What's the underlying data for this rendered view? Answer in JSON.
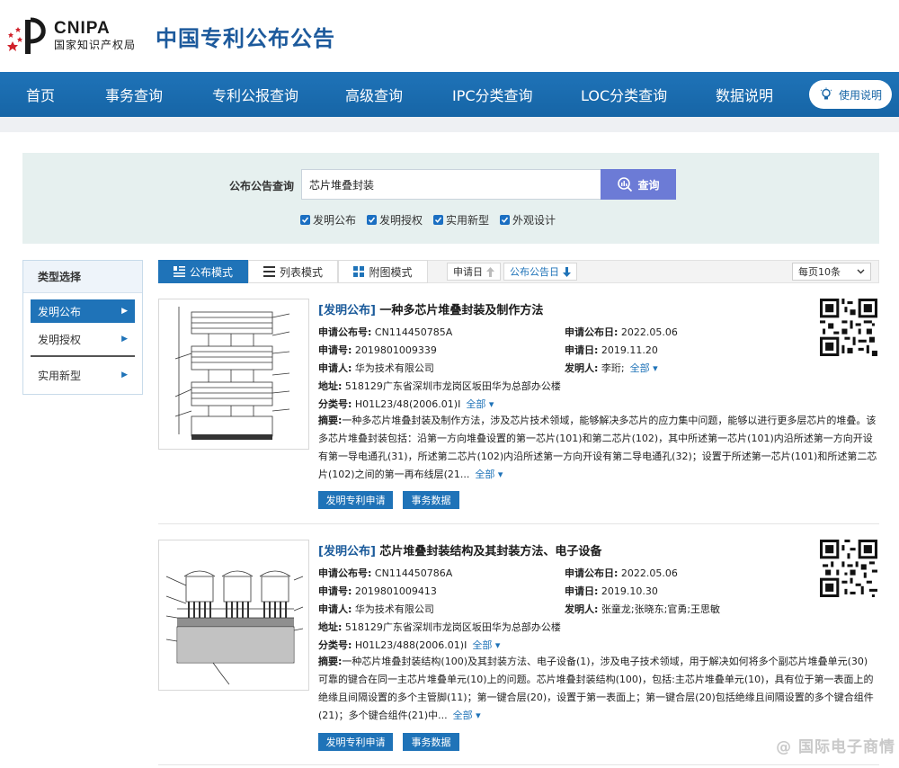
{
  "header": {
    "logo_en": "CNIPA",
    "logo_cn": "国家知识产权局",
    "site_title": "中国专利公布公告"
  },
  "nav": {
    "items": [
      "首页",
      "事务查询",
      "专利公报查询",
      "高级查询",
      "IPC分类查询",
      "LOC分类查询",
      "数据说明"
    ],
    "help_label": "使用说明"
  },
  "search": {
    "label": "公布公告查询",
    "query": "芯片堆叠封装",
    "button": "查询",
    "checks": [
      "发明公布",
      "发明授权",
      "实用新型",
      "外观设计"
    ]
  },
  "sidebar": {
    "title": "类型选择",
    "items": [
      "发明公布",
      "发明授权",
      "实用新型"
    ],
    "active": "发明公布"
  },
  "toolbar": {
    "modes": [
      "公布模式",
      "列表模式",
      "附图模式"
    ],
    "sort": [
      "申请日",
      "公布公告日"
    ],
    "per_page": "每页10条"
  },
  "results": [
    {
      "tag": "[发明公布]",
      "title": "一种多芯片堆叠封装及制作方法",
      "pub_no_label": "申请公布号:",
      "pub_no": "CN114450785A",
      "pub_date_label": "申请公布日:",
      "pub_date": "2022.05.06",
      "app_no_label": "申请号:",
      "app_no": "2019801009339",
      "app_date_label": "申请日:",
      "app_date": "2019.11.20",
      "applicant_label": "申请人:",
      "applicant": "华为技术有限公司",
      "inventor_label": "发明人:",
      "inventor": "李珩;",
      "address_label": "地址:",
      "address": "518129广东省深圳市龙岗区坂田华为总部办公楼",
      "class_label": "分类号:",
      "class": "H01L23/48(2006.01)I",
      "more": "全部",
      "abstract_label": "摘要:",
      "abstract": "一种多芯片堆叠封装及制作方法，涉及芯片技术领域，能够解决多芯片的应力集中问题，能够以进行更多层芯片的堆叠。该多芯片堆叠封装包括：沿第一方向堆叠设置的第一芯片(101)和第二芯片(102)，其中所述第一芯片(101)内沿所述第一方向开设有第一导电通孔(31)，所述第二芯片(102)内沿所述第一方向开设有第二导电通孔(32)；设置于所述第一芯片(101)和所述第二芯片(102)之间的第一再布线层(21...",
      "btn_apply": "发明专利申请",
      "btn_data": "事务数据"
    },
    {
      "tag": "[发明公布]",
      "title": "芯片堆叠封装结构及其封装方法、电子设备",
      "pub_no_label": "申请公布号:",
      "pub_no": "CN114450786A",
      "pub_date_label": "申请公布日:",
      "pub_date": "2022.05.06",
      "app_no_label": "申请号:",
      "app_no": "2019801009413",
      "app_date_label": "申请日:",
      "app_date": "2019.10.30",
      "applicant_label": "申请人:",
      "applicant": "华为技术有限公司",
      "inventor_label": "发明人:",
      "inventor": "张童龙;张晓东;官勇;王思敏",
      "address_label": "地址:",
      "address": "518129广东省深圳市龙岗区坂田华为总部办公楼",
      "class_label": "分类号:",
      "class": "H01L23/488(2006.01)I",
      "more": "全部",
      "abstract_label": "摘要:",
      "abstract": "一种芯片堆叠封装结构(100)及其封装方法、电子设备(1)，涉及电子技术领域，用于解决如何将多个副芯片堆叠单元(30)可靠的键合在同一主芯片堆叠单元(10)上的问题。芯片堆叠封装结构(100)，包括:主芯片堆叠单元(10)，具有位于第一表面上的绝缘且间隔设置的多个主管脚(11)；第一键合层(20)，设置于第一表面上；第一键合层(20)包括绝缘且间隔设置的多个键合组件(21)；多个键合组件(21)中...",
      "btn_apply": "发明专利申请",
      "btn_data": "事务数据"
    }
  ],
  "watermark": "@ 国际电子商情",
  "colors": {
    "brand_blue": "#1f73b8",
    "title_blue": "#1d5a9c",
    "search_btn": "#6c7bd6",
    "panel_bg": "#e6f0ef"
  }
}
